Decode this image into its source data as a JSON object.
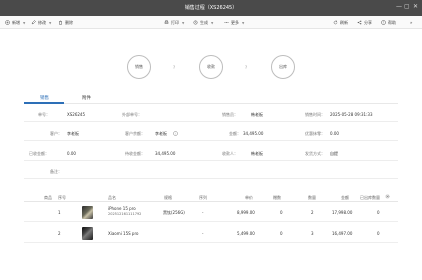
{
  "window": {
    "title": "销售过程（XS26245）",
    "controls": [
      "—",
      "▢",
      "✕"
    ]
  },
  "toolbar": {
    "left": [
      {
        "icon": "plus-circle-icon",
        "label": "新增"
      },
      {
        "icon": "edit-icon",
        "label": "修改"
      },
      {
        "icon": "trash-icon",
        "label": "删除"
      }
    ],
    "center": [
      {
        "icon": "print-icon",
        "label": "打印"
      },
      {
        "icon": "generate-icon",
        "label": "生成"
      },
      {
        "icon": "more-icon",
        "label": "更多"
      }
    ],
    "right": [
      {
        "icon": "refresh-icon",
        "label": "刷新"
      },
      {
        "icon": "share-icon",
        "label": "分享"
      },
      {
        "icon": "help-icon",
        "label": "帮助"
      }
    ],
    "collapse": "»"
  },
  "flow": {
    "nodes": [
      "销售",
      "收款",
      "出库"
    ],
    "arrows": [
      "?",
      "?"
    ]
  },
  "tabs": {
    "items": [
      "销售",
      "附件"
    ],
    "active": 0
  },
  "form": {
    "row1": {
      "code_label": "单号：",
      "code_value": "XS26245",
      "ext_label": "外部单号：",
      "ext_value": "",
      "sales_label": "销售员：",
      "sales_value": "韩老板",
      "time_label": "销售时间：",
      "time_value": "2025-05-28 09:31:33"
    },
    "row2": {
      "customer_label": "客户：",
      "customer_value": "李老板",
      "balance_label": "客户余额：",
      "balance_value": "李老板",
      "amount_label": "金额：",
      "amount_value": "34,495.00",
      "discount_label": "优惠抹零：",
      "discount_value": "0.00"
    },
    "row3": {
      "paid_label": "已收金额：",
      "paid_value": "0.00",
      "due_label": "待收金额：",
      "due_value": "34,495.00",
      "receiver_label": "收款人：",
      "receiver_value": "韩老板",
      "ship_label": "发货方式：",
      "ship_value": "自提"
    },
    "row4": {
      "note_label": "备注：",
      "note_value": ""
    }
  },
  "table": {
    "headers": [
      "商品",
      "序号",
      "品名",
      "规格",
      "序列",
      "单价",
      "赠数",
      "数量",
      "金额",
      "已出库数量"
    ],
    "rows": [
      {
        "seq": "1",
        "name": "iPhone 15 pro",
        "sub": "202512161111792",
        "spec": "黑钛(256G)",
        "serial": "-",
        "price": "8,999.00",
        "gift": "0",
        "qty": "2",
        "amount": "17,998.00",
        "shipped": "0"
      },
      {
        "seq": "2",
        "name": "Xiaomi 15S pro",
        "sub": "",
        "spec": "",
        "serial": "-",
        "price": "5,499.00",
        "gift": "0",
        "qty": "3",
        "amount": "16,497.00",
        "shipped": "0"
      }
    ]
  }
}
